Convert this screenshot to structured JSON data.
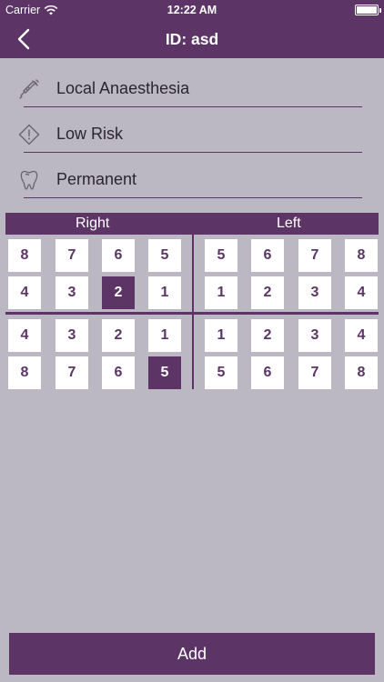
{
  "status_bar": {
    "carrier": "Carrier",
    "time": "12:22 AM"
  },
  "nav": {
    "title": "ID: asd"
  },
  "rows": [
    {
      "icon": "syringe-icon",
      "label": "Local Anaesthesia"
    },
    {
      "icon": "warning-diamond-icon",
      "label": "Low Risk"
    },
    {
      "icon": "tooth-icon",
      "label": "Permanent"
    }
  ],
  "quadrants": {
    "right_label": "Right",
    "left_label": "Left",
    "upper_right": [
      "8",
      "7",
      "6",
      "5",
      "4",
      "3",
      "2",
      "1"
    ],
    "upper_left": [
      "5",
      "6",
      "7",
      "8",
      "1",
      "2",
      "3",
      "4"
    ],
    "lower_right": [
      "4",
      "3",
      "2",
      "1",
      "8",
      "7",
      "6",
      "5"
    ],
    "lower_left": [
      "1",
      "2",
      "3",
      "4",
      "5",
      "6",
      "7",
      "8"
    ],
    "selected": [
      "upper_right.2",
      "lower_right.5"
    ]
  },
  "add_button": {
    "label": "Add"
  },
  "colors": {
    "accent": "#5c3566",
    "background": "#bbb8c3"
  }
}
